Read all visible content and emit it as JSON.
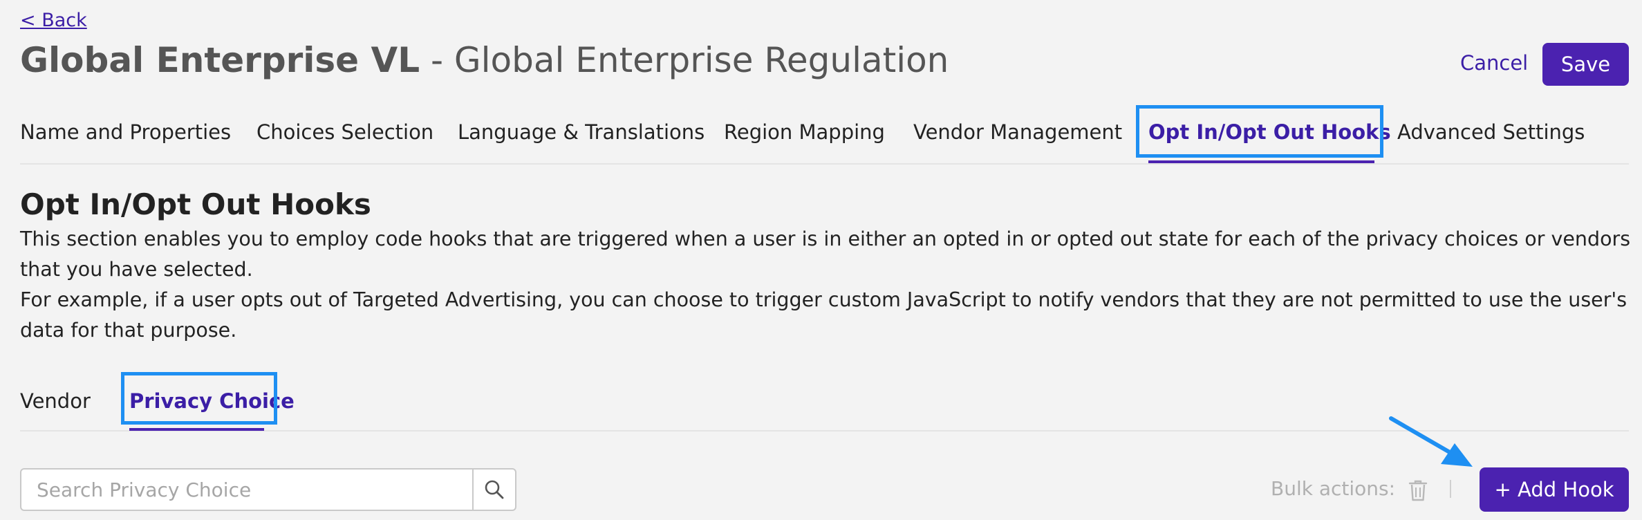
{
  "header": {
    "back_label": "< Back",
    "title_bold": "Global Enterprise VL",
    "title_rest": " - Global Enterprise Regulation",
    "cancel_label": "Cancel",
    "save_label": "Save"
  },
  "tabs": [
    {
      "label": "Name and Properties",
      "active": false
    },
    {
      "label": "Choices Selection",
      "active": false
    },
    {
      "label": "Language & Translations",
      "active": false
    },
    {
      "label": "Region Mapping",
      "active": false
    },
    {
      "label": "Vendor Management",
      "active": false
    },
    {
      "label": "Opt In/Opt Out Hooks",
      "active": true
    },
    {
      "label": "Advanced Settings",
      "active": false
    }
  ],
  "section": {
    "title": "Opt In/Opt Out Hooks",
    "desc_line1": "This section enables you to employ code hooks that are triggered when a user is in either an opted in or opted out state for each of the privacy choices or vendors that you have selected.",
    "desc_line2": "For example, if a user opts out of Targeted Advertising, you can choose to trigger custom JavaScript to notify vendors that they are not permitted to use the user's data for that purpose."
  },
  "sub_tabs": [
    {
      "label": "Vendor",
      "active": false
    },
    {
      "label": "Privacy Choice",
      "active": true
    }
  ],
  "toolbar": {
    "search_placeholder": "Search Privacy Choice",
    "search_value": "",
    "bulk_actions_label": "Bulk actions:",
    "add_hook_label": "+ Add Hook"
  },
  "icons": {
    "search": "search-icon",
    "delete": "trash-icon",
    "annotation": "arrow-icon"
  },
  "colors": {
    "accent": "#4b22b0",
    "accent_text": "#3b1ea6",
    "highlight": "#1e8ff2",
    "background": "#f3f3f3"
  }
}
